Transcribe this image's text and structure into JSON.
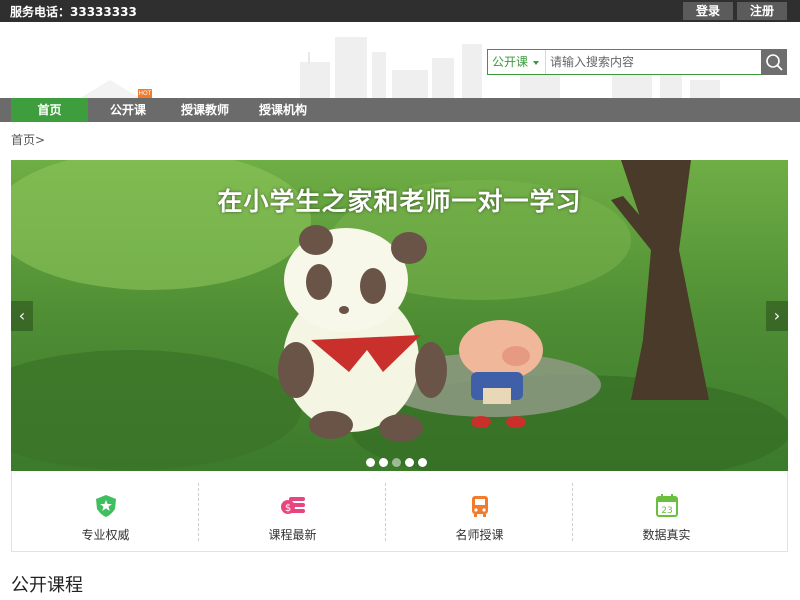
{
  "topbar": {
    "phone": "服务电话：33333333",
    "login": "登录",
    "register": "注册"
  },
  "search": {
    "category": "公开课",
    "placeholder": "请输入搜索内容"
  },
  "nav": {
    "items": [
      "首页",
      "公开课",
      "授课教师",
      "授课机构"
    ],
    "hot_badge": "HOT"
  },
  "breadcrumb": "首页>",
  "banner": {
    "caption": "在小学生之家和老师一对一学习",
    "slide_count": 5,
    "active_slide": 4
  },
  "features": [
    {
      "label": "专业权威",
      "icon": "shield-icon",
      "color": "#3fbf5f"
    },
    {
      "label": "课程最新",
      "icon": "coin-stack-icon",
      "color": "#e8457f"
    },
    {
      "label": "名师授课",
      "icon": "bus-icon",
      "color": "#f07c2c"
    },
    {
      "label": "数据真实",
      "icon": "calendar-icon",
      "color": "#6cbf3c",
      "icon_text": "23"
    }
  ],
  "section_title": "公开课程",
  "colors": {
    "accent_green": "#3e9e3e",
    "nav_gray": "#6b6b6b",
    "topbar": "#2f2f2f"
  }
}
